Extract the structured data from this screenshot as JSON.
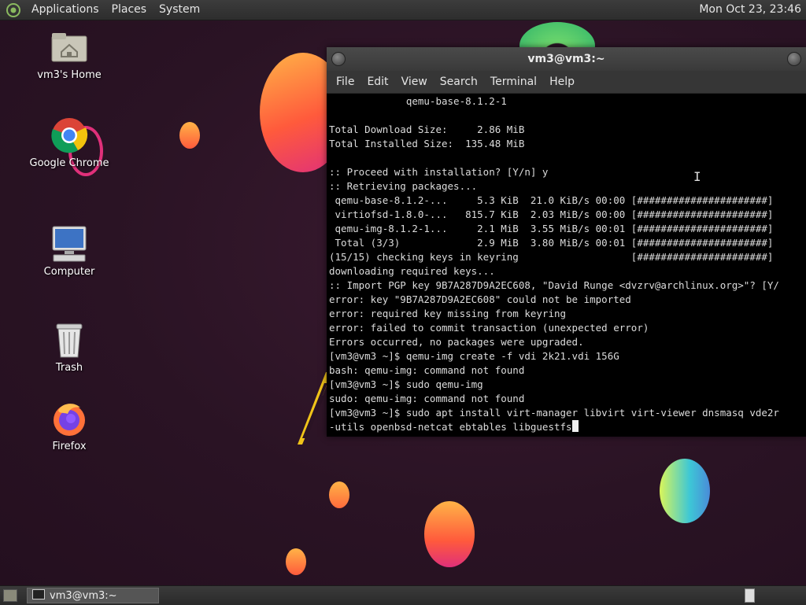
{
  "top_panel": {
    "menus": [
      "Applications",
      "Places",
      "System"
    ],
    "clock": "Mon Oct 23, 23:46"
  },
  "desktop_icons": {
    "home": "vm3's Home",
    "chrome": "Google Chrome",
    "computer": "Computer",
    "trash": "Trash",
    "firefox": "Firefox"
  },
  "window": {
    "title": "vm3@vm3:~",
    "menus": [
      "File",
      "Edit",
      "View",
      "Search",
      "Terminal",
      "Help"
    ],
    "terminal_lines": [
      "             qemu-base-8.1.2-1",
      "",
      "Total Download Size:     2.86 MiB",
      "Total Installed Size:  135.48 MiB",
      "",
      ":: Proceed with installation? [Y/n] y",
      ":: Retrieving packages...",
      " qemu-base-8.1.2-...     5.3 KiB  21.0 KiB/s 00:00 [######################]",
      " virtiofsd-1.8.0-...   815.7 KiB  2.03 MiB/s 00:00 [######################]",
      " qemu-img-8.1.2-1...     2.1 MiB  3.55 MiB/s 00:01 [######################]",
      " Total (3/3)             2.9 MiB  3.80 MiB/s 00:01 [######################]",
      "(15/15) checking keys in keyring                   [######################]",
      "downloading required keys...",
      ":: Import PGP key 9B7A287D9A2EC608, \"David Runge <dvzrv@archlinux.org>\"? [Y/",
      "error: key \"9B7A287D9A2EC608\" could not be imported",
      "error: required key missing from keyring",
      "error: failed to commit transaction (unexpected error)",
      "Errors occurred, no packages were upgraded.",
      "[vm3@vm3 ~]$ qemu-img create -f vdi 2k21.vdi 156G",
      "bash: qemu-img: command not found",
      "[vm3@vm3 ~]$ sudo qemu-img",
      "sudo: qemu-img: command not found",
      "[vm3@vm3 ~]$ sudo apt install virt-manager libvirt virt-viewer dnsmasq vde2r"
    ],
    "terminal_last_line": "-utils openbsd-netcat ebtables libguestfs"
  },
  "bottom_panel": {
    "task_label": "vm3@vm3:~"
  },
  "colors": {
    "terminal_bg": "#000000",
    "terminal_fg": "#dcdcdc",
    "panel_bg": "#2d2d2d"
  }
}
